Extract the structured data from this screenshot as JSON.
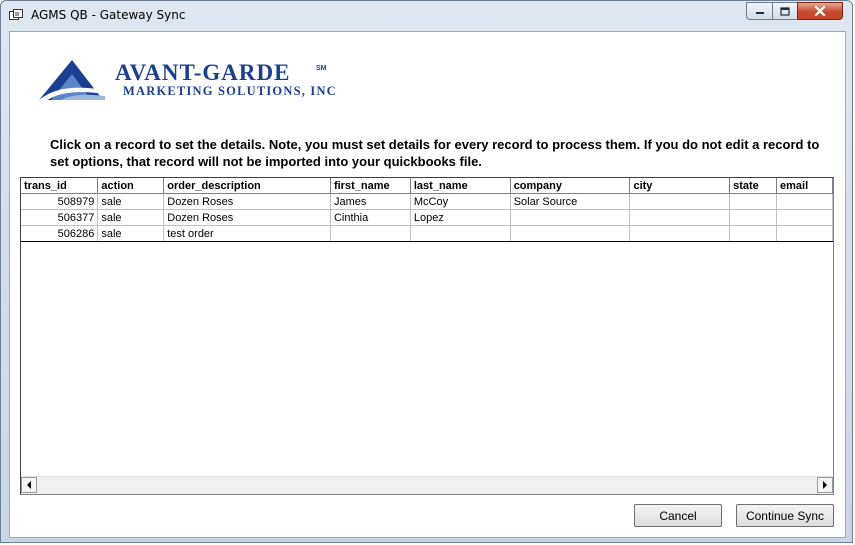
{
  "window": {
    "title": "AGMS QB - Gateway Sync"
  },
  "logo": {
    "line1": "AVANT-GARDE",
    "sm": "SM",
    "line2": "MARKETING SOLUTIONS, INC."
  },
  "instructions": "Click on a record to set the details.  Note, you must set details for every record to process them.  If you do not edit a record to set options, that record will not be imported into your quickbooks file.",
  "grid": {
    "columns": [
      "trans_id",
      "action",
      "order_description",
      "first_name",
      "last_name",
      "company",
      "city",
      "state",
      "email"
    ],
    "rows": [
      [
        "508979",
        "sale",
        "Dozen Roses",
        "James",
        "McCoy",
        "Solar Source",
        "",
        "",
        ""
      ],
      [
        "506377",
        "sale",
        "Dozen Roses",
        "Cinthia",
        "Lopez",
        "",
        "",
        "",
        ""
      ],
      [
        "506286",
        "sale",
        "test order",
        "",
        "",
        "",
        "",
        "",
        ""
      ]
    ]
  },
  "buttons": {
    "cancel": "Cancel",
    "continue": "Continue Sync"
  },
  "colors": {
    "logo_blue": "#1b3f8f",
    "close_red": "#c74a33"
  }
}
